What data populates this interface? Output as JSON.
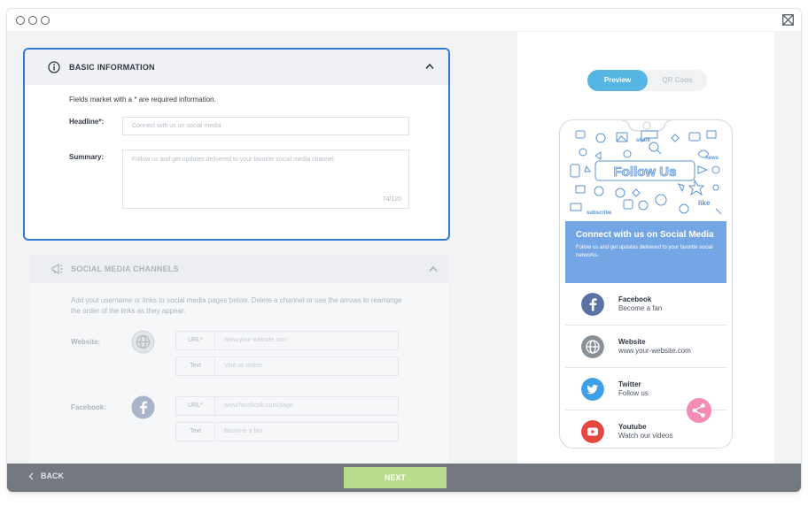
{
  "basic_info": {
    "title": "BASIC INFORMATION",
    "required_note": "Fields market with a * are required information.",
    "headline_label": "Headline*:",
    "headline_placeholder": "Connect with us on social media",
    "summary_label": "Summary:",
    "summary_placeholder": "Follow us and get updates delivered to your favorite social media channel.",
    "char_count": "74/120"
  },
  "social_channels": {
    "title": "SOCIAL MEDIA CHANNELS",
    "description": "Add yout username or links to social media pages below. Delete a channel or use the arrows to rearrange the order of the links as they appear.",
    "website": {
      "label": "Website:",
      "url_prefix": "URL*",
      "url_placeholder": "www.your-website.com",
      "text_prefix": "Text",
      "text_placeholder": "Visit us online"
    },
    "facebook": {
      "label": "Facebook:",
      "url_prefix": "URL*",
      "url_placeholder": "www.facebook.com/page",
      "text_prefix": "Text",
      "text_placeholder": "Become a fan"
    }
  },
  "preview": {
    "tab_preview": "Preview",
    "tab_qr": "QR Code",
    "hero_text": "Follow Us",
    "hero_words": [
      "share",
      "news",
      "like",
      "subscribe"
    ],
    "banner_title": "Connect with us on Social Media",
    "banner_sub": "Follow us and get updates delivered to your favorite social networks.",
    "channels": [
      {
        "name": "Facebook",
        "sub": "Become a fan",
        "icon": "facebook-icon",
        "color": "#5b72a6"
      },
      {
        "name": "Website",
        "sub": "www.your-website.com",
        "icon": "globe-icon",
        "color": "#8a9097"
      },
      {
        "name": "Twitter",
        "sub": "Follow us",
        "icon": "twitter-icon",
        "color": "#3ea1e8"
      },
      {
        "name": "Youtube",
        "sub": "Watch our videos",
        "icon": "youtube-icon",
        "color": "#e4483f"
      }
    ]
  },
  "footer": {
    "back_label": "BACK",
    "next_label": "NEXT"
  },
  "colors": {
    "accent": "#2f7bd3",
    "tab_active": "#55b5e3",
    "banner": "#74a6e6",
    "next": "#b8dc8d",
    "share": "#f28cb4",
    "footer": "#747980"
  }
}
